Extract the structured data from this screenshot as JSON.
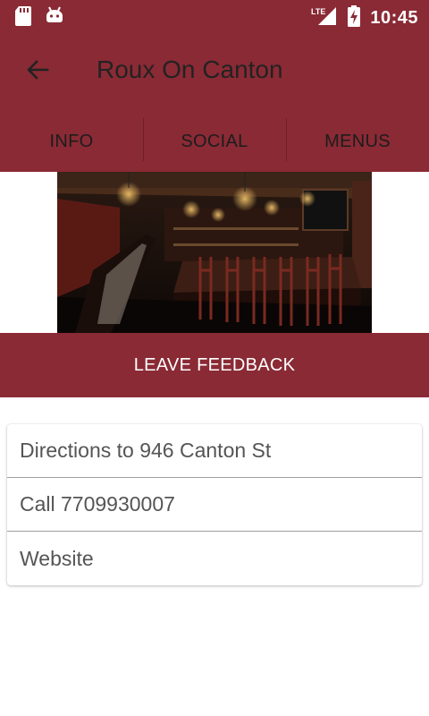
{
  "status_bar": {
    "time": "10:45",
    "network": "LTE",
    "icons": [
      "sd-card-icon",
      "android-icon",
      "signal-icon",
      "battery-charging-icon"
    ]
  },
  "app_bar": {
    "title": "Roux On Canton",
    "back_icon": "arrow-left-icon"
  },
  "tabs": [
    {
      "label": "INFO"
    },
    {
      "label": "SOCIAL"
    },
    {
      "label": "MENUS"
    }
  ],
  "feedback_button": {
    "label": "LEAVE FEEDBACK"
  },
  "info_list": [
    {
      "label": "Directions to 946 Canton St"
    },
    {
      "label": "Call 7709930007"
    },
    {
      "label": "Website"
    }
  ],
  "colors": {
    "primary": "#8a2a35",
    "text_dark": "#222222",
    "text_muted": "#555555"
  }
}
